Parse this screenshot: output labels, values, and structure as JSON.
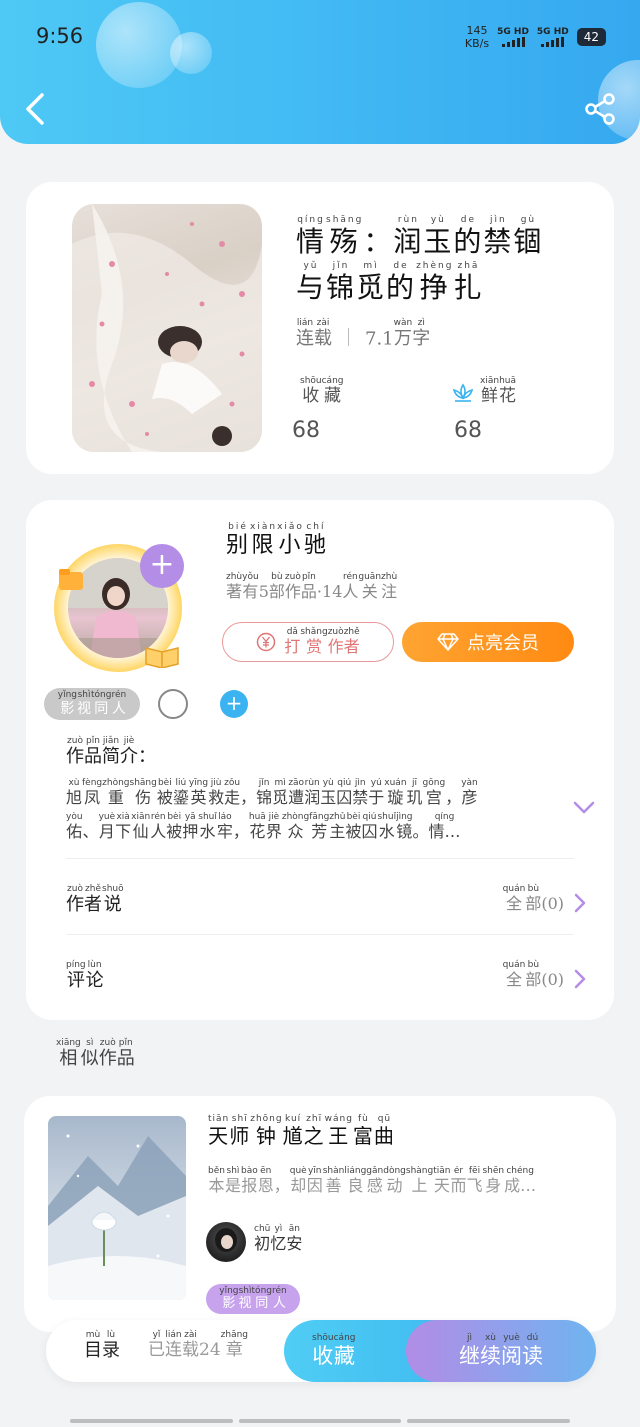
{
  "status_bar": {
    "time": "9:56",
    "speed": "145",
    "speed_unit": "KB/s",
    "net1": "5G HD",
    "net2": "5G HD",
    "battery": "42"
  },
  "header": {
    "back_icon": "chevron-left-icon",
    "share_icon": "share-icon",
    "accent": "#3fb6f3"
  },
  "book": {
    "title_line1": [
      {
        "c": "情",
        "p": "qíng"
      },
      {
        "c": "殇",
        "p": "shāng"
      },
      {
        "c": "：",
        "p": ""
      },
      {
        "c": "润",
        "p": "rùn"
      },
      {
        "c": "玉",
        "p": "yù"
      },
      {
        "c": "的",
        "p": "de"
      },
      {
        "c": "禁",
        "p": "jìn"
      },
      {
        "c": "锢",
        "p": "gù"
      }
    ],
    "title_line2": [
      {
        "c": "与",
        "p": "yǔ"
      },
      {
        "c": "锦",
        "p": "jǐn"
      },
      {
        "c": "觅",
        "p": "mì"
      },
      {
        "c": "的",
        "p": "de"
      },
      {
        "c": "挣",
        "p": "zhèng"
      },
      {
        "c": "扎",
        "p": "zhā"
      }
    ],
    "status": [
      {
        "c": "连",
        "p": "lián"
      },
      {
        "c": "载",
        "p": "zài"
      }
    ],
    "word_count_prefix": "7.1",
    "word_count_unit": [
      {
        "c": "万",
        "p": "wàn"
      },
      {
        "c": "字",
        "p": "zì"
      }
    ],
    "fav_label": [
      {
        "c": "收",
        "p": "shōu"
      },
      {
        "c": "藏",
        "p": "cáng"
      }
    ],
    "fav_count": "68",
    "flower_label": [
      {
        "c": "鲜",
        "p": "xiān"
      },
      {
        "c": "花",
        "p": "huā"
      }
    ],
    "flower_count": "68"
  },
  "author": {
    "name": [
      {
        "c": "别",
        "p": "bié"
      },
      {
        "c": "限",
        "p": "xiàn"
      },
      {
        "c": "小",
        "p": "xiǎo"
      },
      {
        "c": "驰",
        "p": "chí"
      }
    ],
    "meta": [
      {
        "c": "著",
        "p": "zhù"
      },
      {
        "c": "有",
        "p": "yǒu"
      },
      {
        "c": "5",
        "p": ""
      },
      {
        "c": "部",
        "p": "bù"
      },
      {
        "c": "作",
        "p": "zuò"
      },
      {
        "c": "品",
        "p": "pǐn"
      },
      {
        "c": "·14",
        "p": ""
      },
      {
        "c": "人",
        "p": "rén"
      },
      {
        "c": "关",
        "p": "guān"
      },
      {
        "c": "注",
        "p": "zhù"
      }
    ],
    "tip_label": [
      {
        "c": "打",
        "p": "dǎ"
      },
      {
        "c": "赏",
        "p": "shǎng"
      },
      {
        "c": "作",
        "p": "zuò"
      },
      {
        "c": "者",
        "p": "zhě"
      }
    ],
    "tip_icon": "yen-coin-icon",
    "vip_label": "点亮会员",
    "vip_icon": "diamond-icon",
    "tag": [
      {
        "c": "影",
        "p": "yǐng"
      },
      {
        "c": "视",
        "p": "shì"
      },
      {
        "c": "同",
        "p": "tóng"
      },
      {
        "c": "人",
        "p": "rén"
      }
    ],
    "add_symbol": "+"
  },
  "intro": {
    "heading": [
      {
        "c": "作",
        "p": "zuò"
      },
      {
        "c": "品",
        "p": "pǐn"
      },
      {
        "c": "简",
        "p": "jiǎn"
      },
      {
        "c": "介",
        "p": "jiè"
      },
      {
        "c": "：",
        "p": ""
      }
    ],
    "line1": [
      {
        "c": "旭",
        "p": "xù"
      },
      {
        "c": "凤",
        "p": "fèng"
      },
      {
        "c": "重",
        "p": "zhòng"
      },
      {
        "c": "伤",
        "p": "shāng"
      },
      {
        "c": "被",
        "p": "bèi"
      },
      {
        "c": "鎏",
        "p": "liú"
      },
      {
        "c": "英",
        "p": "yīng"
      },
      {
        "c": "救",
        "p": "jiù"
      },
      {
        "c": "走",
        "p": "zǒu"
      },
      {
        "c": "，",
        "p": ""
      },
      {
        "c": "锦",
        "p": "jǐn"
      },
      {
        "c": "觅",
        "p": "mì"
      },
      {
        "c": "遭",
        "p": "zāo"
      },
      {
        "c": "润",
        "p": "rùn"
      },
      {
        "c": "玉",
        "p": "yù"
      },
      {
        "c": "囚",
        "p": "qiú"
      },
      {
        "c": "禁",
        "p": "jìn"
      },
      {
        "c": "于",
        "p": "yú"
      },
      {
        "c": "璇",
        "p": "xuán"
      },
      {
        "c": "玑",
        "p": "jī"
      },
      {
        "c": "宫",
        "p": "gōng"
      },
      {
        "c": "，",
        "p": ""
      },
      {
        "c": "彦",
        "p": "yàn"
      }
    ],
    "line2": [
      {
        "c": "佑",
        "p": "yòu"
      },
      {
        "c": "、",
        "p": ""
      },
      {
        "c": "月",
        "p": "yuè"
      },
      {
        "c": "下",
        "p": "xià"
      },
      {
        "c": "仙",
        "p": "xiān"
      },
      {
        "c": "人",
        "p": "rén"
      },
      {
        "c": "被",
        "p": "bèi"
      },
      {
        "c": "押",
        "p": "yā"
      },
      {
        "c": "水",
        "p": "shuǐ"
      },
      {
        "c": "牢",
        "p": "láo"
      },
      {
        "c": "，",
        "p": ""
      },
      {
        "c": "花",
        "p": "huā"
      },
      {
        "c": "界",
        "p": "jiè"
      },
      {
        "c": "众",
        "p": "zhòng"
      },
      {
        "c": "芳",
        "p": "fāng"
      },
      {
        "c": "主",
        "p": "zhǔ"
      },
      {
        "c": "被",
        "p": "bèi"
      },
      {
        "c": "囚",
        "p": "qiú"
      },
      {
        "c": "水",
        "p": "shuǐ"
      },
      {
        "c": "镜",
        "p": "jìng"
      },
      {
        "c": "。",
        "p": ""
      },
      {
        "c": "情…",
        "p": "qíng"
      }
    ],
    "expand_icon": "chevron-down-icon"
  },
  "author_says": {
    "label": [
      {
        "c": "作",
        "p": "zuò"
      },
      {
        "c": "者",
        "p": "zhě"
      },
      {
        "c": "说",
        "p": "shuō"
      }
    ],
    "all": [
      {
        "c": "全",
        "p": "quán"
      },
      {
        "c": "部",
        "p": "bù"
      },
      {
        "c": "(0)",
        "p": ""
      }
    ]
  },
  "comments": {
    "label": [
      {
        "c": "评",
        "p": "píng"
      },
      {
        "c": "论",
        "p": "lùn"
      }
    ],
    "all": [
      {
        "c": "全",
        "p": "quán"
      },
      {
        "c": "部",
        "p": "bù"
      },
      {
        "c": "(0)",
        "p": ""
      }
    ]
  },
  "similar": {
    "heading": [
      {
        "c": "相",
        "p": "xiāng"
      },
      {
        "c": "似",
        "p": "sì"
      },
      {
        "c": "作",
        "p": "zuò"
      },
      {
        "c": "品",
        "p": "pǐn"
      }
    ],
    "item": {
      "title": [
        {
          "c": "天",
          "p": "tiān"
        },
        {
          "c": "师",
          "p": "shī"
        },
        {
          "c": "钟",
          "p": "zhōng"
        },
        {
          "c": "馗",
          "p": "kuí"
        },
        {
          "c": "之",
          "p": "zhī"
        },
        {
          "c": "王",
          "p": "wáng"
        },
        {
          "c": "富",
          "p": "fù"
        },
        {
          "c": "曲",
          "p": "qū"
        }
      ],
      "desc": [
        {
          "c": "本",
          "p": "běn"
        },
        {
          "c": "是",
          "p": "shì"
        },
        {
          "c": "报",
          "p": "bào"
        },
        {
          "c": "恩",
          "p": "ēn"
        },
        {
          "c": "，",
          "p": ""
        },
        {
          "c": "却",
          "p": "què"
        },
        {
          "c": "因",
          "p": "yīn"
        },
        {
          "c": "善",
          "p": "shàn"
        },
        {
          "c": "良",
          "p": "liáng"
        },
        {
          "c": "感",
          "p": "gǎn"
        },
        {
          "c": "动",
          "p": "dòng"
        },
        {
          "c": "上",
          "p": "shàng"
        },
        {
          "c": "天",
          "p": "tiān"
        },
        {
          "c": "而",
          "p": "ér"
        },
        {
          "c": "飞",
          "p": "fēi"
        },
        {
          "c": "身",
          "p": "shēn"
        },
        {
          "c": "成…",
          "p": "chéng"
        }
      ],
      "author": [
        {
          "c": "初",
          "p": "chū"
        },
        {
          "c": "忆",
          "p": "yì"
        },
        {
          "c": "安",
          "p": "ān"
        }
      ],
      "tag": [
        {
          "c": "影",
          "p": "yǐng"
        },
        {
          "c": "视",
          "p": "shì"
        },
        {
          "c": "同",
          "p": "tóng"
        },
        {
          "c": "人",
          "p": "rén"
        }
      ]
    }
  },
  "bottom_bar": {
    "toc": [
      {
        "c": "目",
        "p": "mù"
      },
      {
        "c": "录",
        "p": "lù"
      }
    ],
    "chapters": [
      {
        "c": "已",
        "p": "yǐ"
      },
      {
        "c": "连",
        "p": "lián"
      },
      {
        "c": "载",
        "p": "zài"
      },
      {
        "c": "24",
        "p": ""
      },
      {
        "c": "章",
        "p": "zhāng"
      }
    ],
    "fav": [
      {
        "c": "收",
        "p": "shōu"
      },
      {
        "c": "藏",
        "p": "cáng"
      }
    ],
    "read": [
      {
        "c": "继",
        "p": "jì"
      },
      {
        "c": "续",
        "p": "xù"
      },
      {
        "c": "阅",
        "p": "yuè"
      },
      {
        "c": "读",
        "p": "dú"
      }
    ]
  }
}
